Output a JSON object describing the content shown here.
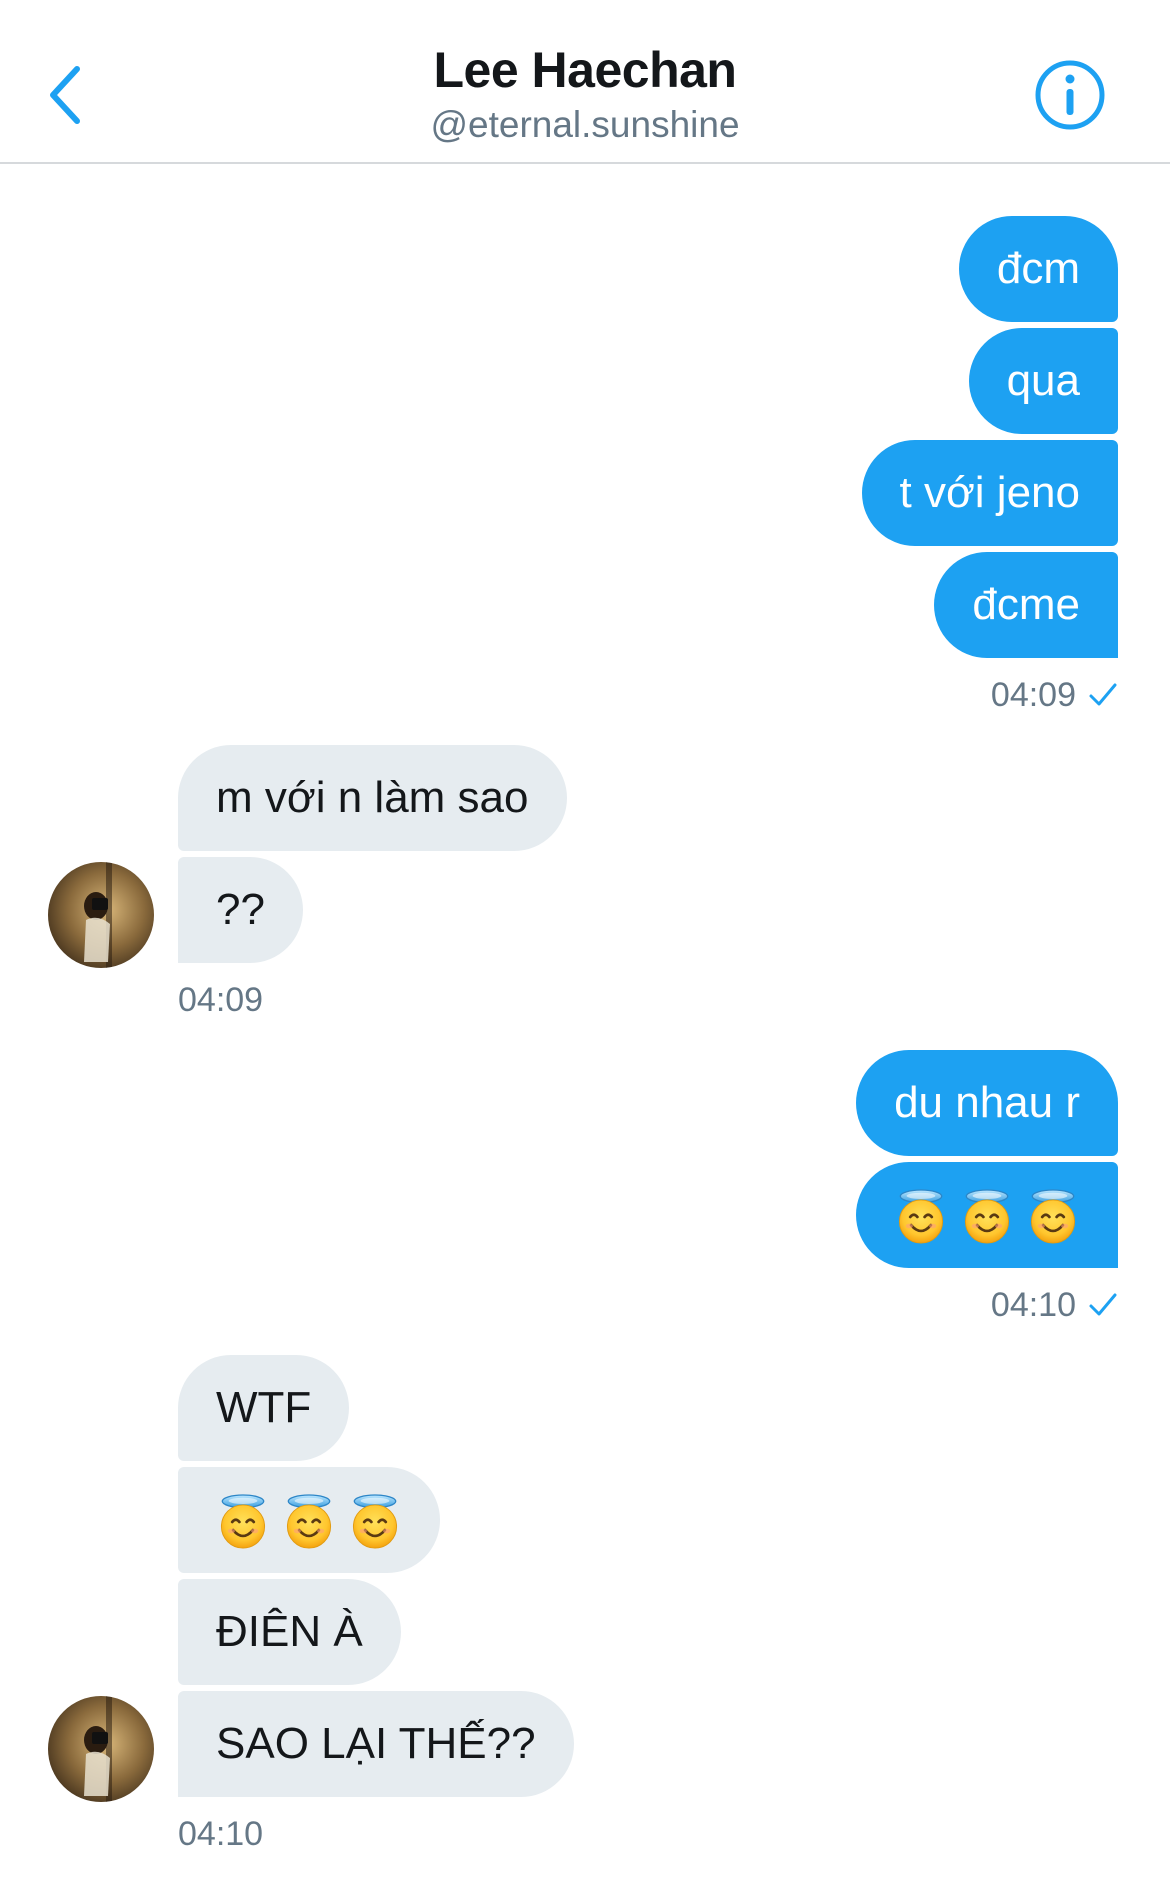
{
  "header": {
    "title": "Lee Haechan",
    "handle": "@eternal.sunshine",
    "back_icon": "chevron-left-icon",
    "info_icon": "info-icon",
    "accent": "#1da1f2"
  },
  "conversation": {
    "group1_sent": [
      "đcm",
      "qua",
      "t với jeno",
      "đcme"
    ],
    "group1_time": "04:09",
    "group2_recv": [
      "m với n làm sao",
      "??"
    ],
    "group2_time": "04:09",
    "group3_sent": [
      "du nhau r"
    ],
    "group3_emoji": "smiling-face-with-halo x3",
    "group3_time": "04:10",
    "group4_recv": [
      "WTF",
      "ĐIÊN À",
      "SAO LẠI THẾ??"
    ],
    "group4_emoji": "smiling-face-with-halo x3",
    "group4_time": "04:10"
  },
  "colors": {
    "sent_bubble": "#1da1f2",
    "received_bubble": "#e6ecf0",
    "timestamp": "#657786"
  }
}
